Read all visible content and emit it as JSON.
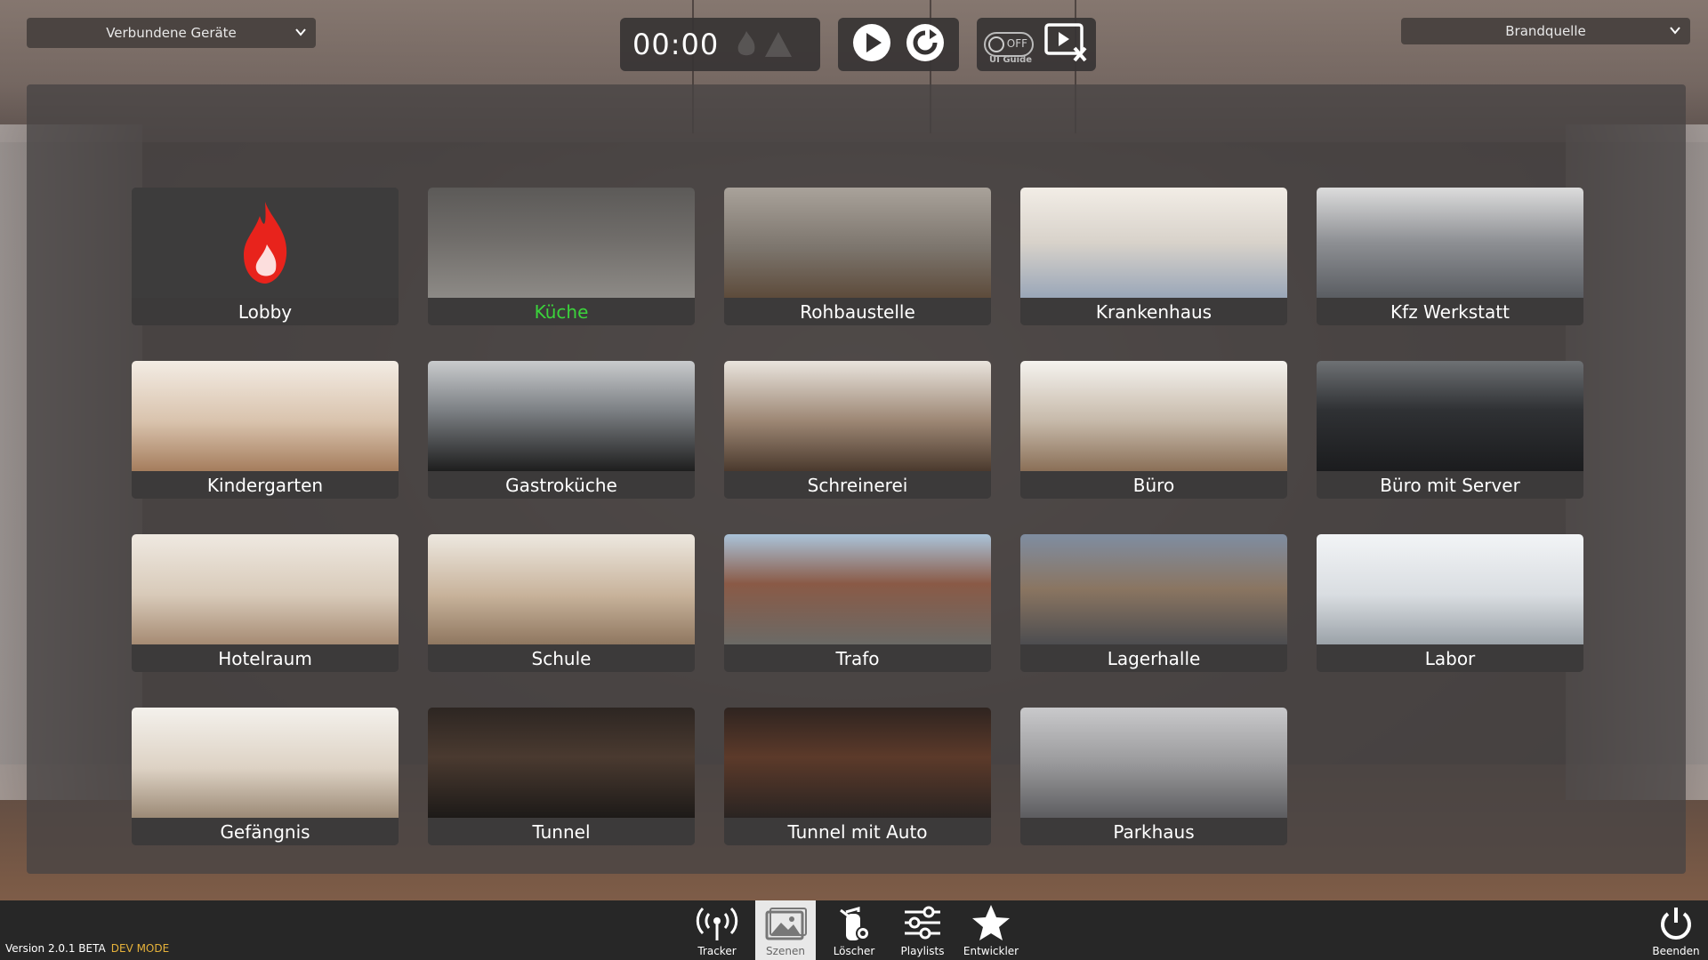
{
  "top": {
    "devices_dropdown": "Verbundene Geräte",
    "source_dropdown": "Brandquelle",
    "timer": "00:00",
    "toggle_state": "OFF",
    "guide_label": "UI Guide"
  },
  "scenes": [
    {
      "label": "Lobby",
      "theme": "lobby"
    },
    {
      "label": "Küche",
      "theme": "kitchen",
      "active": true
    },
    {
      "label": "Rohbaustelle",
      "theme": "construction"
    },
    {
      "label": "Krankenhaus",
      "theme": "hospital"
    },
    {
      "label": "Kfz Werkstatt",
      "theme": "garage"
    },
    {
      "label": "Kindergarten",
      "theme": "kindergarten"
    },
    {
      "label": "Gastroküche",
      "theme": "gastro"
    },
    {
      "label": "Schreinerei",
      "theme": "carpentry"
    },
    {
      "label": "Büro",
      "theme": "office"
    },
    {
      "label": "Büro mit Server",
      "theme": "server"
    },
    {
      "label": "Hotelraum",
      "theme": "hotel"
    },
    {
      "label": "Schule",
      "theme": "school"
    },
    {
      "label": "Trafo",
      "theme": "trafo"
    },
    {
      "label": "Lagerhalle",
      "theme": "warehouse"
    },
    {
      "label": "Labor",
      "theme": "lab"
    },
    {
      "label": "Gefängnis",
      "theme": "prison"
    },
    {
      "label": "Tunnel",
      "theme": "tunnel"
    },
    {
      "label": "Tunnel mit Auto",
      "theme": "tunnelcar"
    },
    {
      "label": "Parkhaus",
      "theme": "parking"
    }
  ],
  "bottom": {
    "version": "Version 2.0.1 BETA",
    "mode": "DEV MODE",
    "nav": [
      "Tracker",
      "Szenen",
      "Löscher",
      "Playlists",
      "Entwickler"
    ],
    "quit": "Beenden"
  },
  "colors": {
    "active_label": "#3bd33b",
    "dev_mode": "#e6b23a",
    "flame": "#e8231c"
  }
}
